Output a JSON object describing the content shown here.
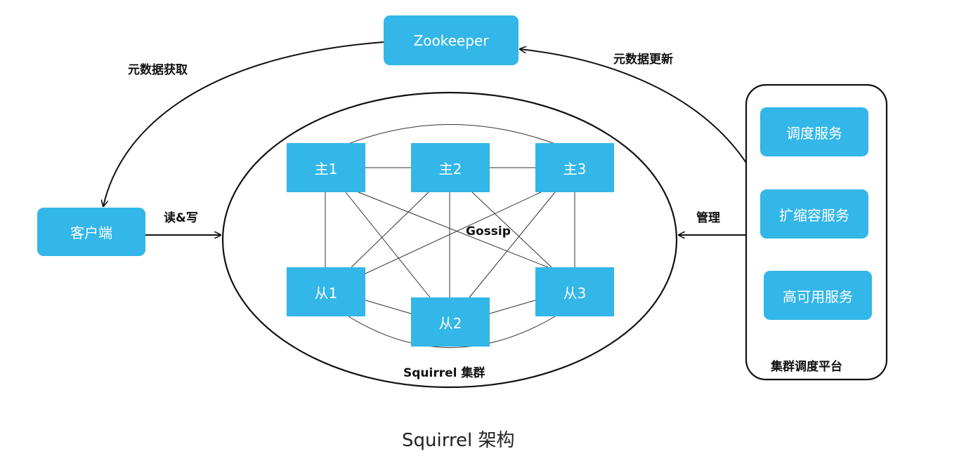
{
  "nodes": {
    "zookeeper": "Zookeeper",
    "client": "客户端",
    "master1": "主1",
    "master2": "主2",
    "master3": "主3",
    "slave1": "从1",
    "slave2": "从2",
    "slave3": "从3",
    "schedule_service": "调度服务",
    "scale_service": "扩缩容服务",
    "ha_service": "高可用服务"
  },
  "labels": {
    "metadata_fetch": "元数据获取",
    "metadata_update": "元数据更新",
    "read_write": "读&写",
    "manage": "管理",
    "gossip": "Gossip",
    "cluster": "Squirrel 集群",
    "platform": "集群调度平台"
  },
  "caption": "Squirrel 架构",
  "colors": {
    "node_fill": "#33b6e8",
    "node_text": "#ffffff",
    "line": "#111111"
  }
}
